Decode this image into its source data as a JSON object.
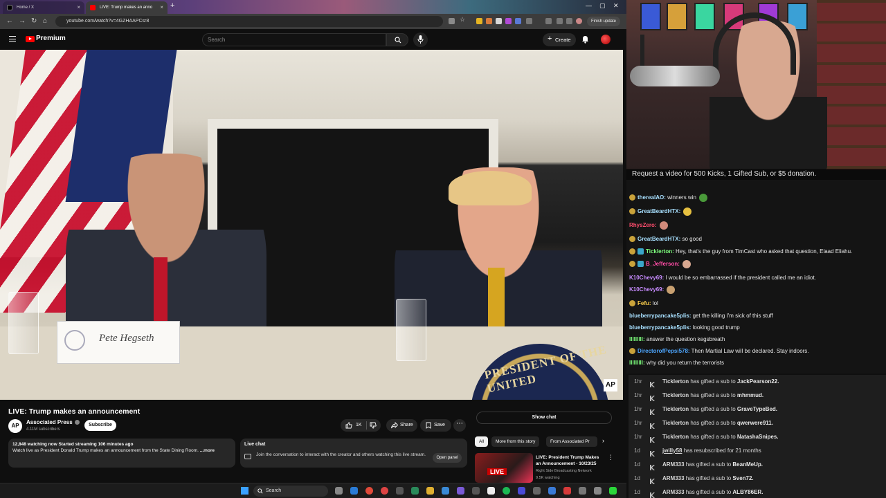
{
  "browser": {
    "tabs": [
      {
        "label": "Home / X"
      },
      {
        "label": "LIVE: Trump makes an anno"
      }
    ],
    "url": "youtube.com/watch?v=4GZHAAPCsr8",
    "finish_update": "Finish update"
  },
  "youtube": {
    "brand": "Premium",
    "search_placeholder": "Search",
    "create_label": "Create"
  },
  "video": {
    "nameplate": "Pete Hegseth",
    "seal_text": "PRESIDENT OF THE UNITED",
    "bug": "AP",
    "title": "LIVE: Trump makes an announcement",
    "channel": {
      "name": "Associated Press",
      "subscribers": "4.11M subscribers",
      "avatar": "AP"
    },
    "subscribe_label": "Subscribe",
    "likes": "1K",
    "share_label": "Share",
    "save_label": "Save",
    "description": {
      "stats": "12,848 watching now  Started streaming 106 minutes ago",
      "text": "Watch live as President Donald Trump makes an announcement from the State Dining Room. ",
      "more": "...more"
    },
    "live_chat": {
      "title": "Live chat",
      "text": "Join the conversation to interact with the creator and others watching this live stream.",
      "open_panel": "Open panel"
    }
  },
  "sidebar": {
    "show_chat": "Show chat",
    "chips": [
      "All",
      "More from this story",
      "From Associated Pr"
    ],
    "recommendation": {
      "live_badge": "LIVE",
      "title": "LIVE: President Trump Makes an Announcement - 10/23/25",
      "channel": "Right Side Broadcasting Network",
      "watching": "9.5K watching"
    }
  },
  "stream": {
    "request_bar": "Request a video for 500 Kicks, 1 Gifted Sub, or $5 donation.",
    "chat": [
      {
        "user": "therealAO:",
        "text": " winners win",
        "color": "#a8e0ff",
        "badge": "g"
      },
      {
        "user": "GreatBeardHTX:",
        "text": "",
        "color": "#a8e0ff",
        "badge": "g"
      },
      {
        "user": "RhysZero:",
        "text": "",
        "color": "#ff4d6d",
        "badge": ""
      },
      {
        "user": "GreatBeardHTX:",
        "text": " so good",
        "color": "#a8e0ff",
        "badge": "g"
      },
      {
        "user": "Ticklerton:",
        "text": " Hey, that's the guy from TimCast who asked that question, Elaad Eliahu.",
        "color": "#7dff7d",
        "badge": "gt"
      },
      {
        "user": "B_Jefferson:",
        "text": "",
        "color": "#ff4da6",
        "badge": "gt"
      },
      {
        "user": "K10Chevy69:",
        "text": " I would be so embarrassed if the president called me an idiot.",
        "color": "#c88cff",
        "badge": ""
      },
      {
        "user": "K10Chevy69:",
        "text": "",
        "color": "#c88cff",
        "badge": ""
      },
      {
        "user": "Fefu:",
        "text": " lol",
        "color": "#ffd24d",
        "badge": "g"
      },
      {
        "user": "blueberrypancake5plis:",
        "text": " get the killing I'm sick of this stuff",
        "color": "#a8e0ff",
        "badge": ""
      },
      {
        "user": "blueberrypancake5plis:",
        "text": " looking good trump",
        "color": "#a8e0ff",
        "badge": ""
      },
      {
        "user": "lllllllll:",
        "text": " answer the question kegsbreath",
        "color": "#7dff7d",
        "badge": ""
      },
      {
        "user": "DirectorofPepsi578:",
        "text": " Then Martial Law will be declared. Stay indoors.",
        "color": "#4da6ff",
        "badge": "g"
      },
      {
        "user": "lllllllll:",
        "text": " why did you return the terrorists",
        "color": "#7dff7d",
        "badge": ""
      }
    ],
    "events": [
      {
        "time": "1hr",
        "user": "Ticklerton",
        "action": " has gifted a sub to ",
        "target": "JackPearson22."
      },
      {
        "time": "1hr",
        "user": "Ticklerton",
        "action": " has gifted a sub to ",
        "target": "mhmmud."
      },
      {
        "time": "1hr",
        "user": "Ticklerton",
        "action": " has gifted a sub to ",
        "target": "GraveTypeBed."
      },
      {
        "time": "1hr",
        "user": "Ticklerton",
        "action": " has gifted a sub to ",
        "target": "qwerwere911."
      },
      {
        "time": "1hr",
        "user": "Ticklerton",
        "action": " has gifted a sub to ",
        "target": "NatashaSnipes."
      },
      {
        "time": "1d",
        "user": "jwilly58",
        "action": " has resubscribed for 21 months",
        "target": ""
      },
      {
        "time": "1d",
        "user": "ARM333",
        "action": " has gifted a sub to ",
        "target": "BeanMeUp."
      },
      {
        "time": "1d",
        "user": "ARM333",
        "action": " has gifted a sub to ",
        "target": "Sven72."
      },
      {
        "time": "1d",
        "user": "ARM333",
        "action": " has gifted a sub to ",
        "target": "ALBY86ER."
      }
    ]
  },
  "taskbar": {
    "search_placeholder": "Search"
  }
}
